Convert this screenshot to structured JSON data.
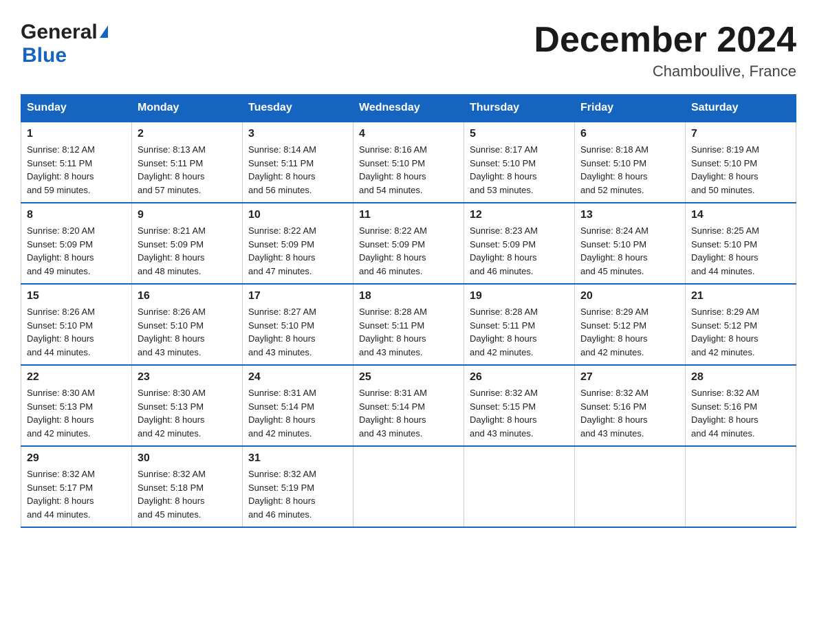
{
  "header": {
    "logo_general": "General",
    "logo_blue": "Blue",
    "title": "December 2024",
    "location": "Chamboulive, France"
  },
  "days_of_week": [
    "Sunday",
    "Monday",
    "Tuesday",
    "Wednesday",
    "Thursday",
    "Friday",
    "Saturday"
  ],
  "weeks": [
    [
      {
        "day": "1",
        "sunrise": "8:12 AM",
        "sunset": "5:11 PM",
        "daylight": "8 hours and 59 minutes."
      },
      {
        "day": "2",
        "sunrise": "8:13 AM",
        "sunset": "5:11 PM",
        "daylight": "8 hours and 57 minutes."
      },
      {
        "day": "3",
        "sunrise": "8:14 AM",
        "sunset": "5:11 PM",
        "daylight": "8 hours and 56 minutes."
      },
      {
        "day": "4",
        "sunrise": "8:16 AM",
        "sunset": "5:10 PM",
        "daylight": "8 hours and 54 minutes."
      },
      {
        "day": "5",
        "sunrise": "8:17 AM",
        "sunset": "5:10 PM",
        "daylight": "8 hours and 53 minutes."
      },
      {
        "day": "6",
        "sunrise": "8:18 AM",
        "sunset": "5:10 PM",
        "daylight": "8 hours and 52 minutes."
      },
      {
        "day": "7",
        "sunrise": "8:19 AM",
        "sunset": "5:10 PM",
        "daylight": "8 hours and 50 minutes."
      }
    ],
    [
      {
        "day": "8",
        "sunrise": "8:20 AM",
        "sunset": "5:09 PM",
        "daylight": "8 hours and 49 minutes."
      },
      {
        "day": "9",
        "sunrise": "8:21 AM",
        "sunset": "5:09 PM",
        "daylight": "8 hours and 48 minutes."
      },
      {
        "day": "10",
        "sunrise": "8:22 AM",
        "sunset": "5:09 PM",
        "daylight": "8 hours and 47 minutes."
      },
      {
        "day": "11",
        "sunrise": "8:22 AM",
        "sunset": "5:09 PM",
        "daylight": "8 hours and 46 minutes."
      },
      {
        "day": "12",
        "sunrise": "8:23 AM",
        "sunset": "5:09 PM",
        "daylight": "8 hours and 46 minutes."
      },
      {
        "day": "13",
        "sunrise": "8:24 AM",
        "sunset": "5:10 PM",
        "daylight": "8 hours and 45 minutes."
      },
      {
        "day": "14",
        "sunrise": "8:25 AM",
        "sunset": "5:10 PM",
        "daylight": "8 hours and 44 minutes."
      }
    ],
    [
      {
        "day": "15",
        "sunrise": "8:26 AM",
        "sunset": "5:10 PM",
        "daylight": "8 hours and 44 minutes."
      },
      {
        "day": "16",
        "sunrise": "8:26 AM",
        "sunset": "5:10 PM",
        "daylight": "8 hours and 43 minutes."
      },
      {
        "day": "17",
        "sunrise": "8:27 AM",
        "sunset": "5:10 PM",
        "daylight": "8 hours and 43 minutes."
      },
      {
        "day": "18",
        "sunrise": "8:28 AM",
        "sunset": "5:11 PM",
        "daylight": "8 hours and 43 minutes."
      },
      {
        "day": "19",
        "sunrise": "8:28 AM",
        "sunset": "5:11 PM",
        "daylight": "8 hours and 42 minutes."
      },
      {
        "day": "20",
        "sunrise": "8:29 AM",
        "sunset": "5:12 PM",
        "daylight": "8 hours and 42 minutes."
      },
      {
        "day": "21",
        "sunrise": "8:29 AM",
        "sunset": "5:12 PM",
        "daylight": "8 hours and 42 minutes."
      }
    ],
    [
      {
        "day": "22",
        "sunrise": "8:30 AM",
        "sunset": "5:13 PM",
        "daylight": "8 hours and 42 minutes."
      },
      {
        "day": "23",
        "sunrise": "8:30 AM",
        "sunset": "5:13 PM",
        "daylight": "8 hours and 42 minutes."
      },
      {
        "day": "24",
        "sunrise": "8:31 AM",
        "sunset": "5:14 PM",
        "daylight": "8 hours and 42 minutes."
      },
      {
        "day": "25",
        "sunrise": "8:31 AM",
        "sunset": "5:14 PM",
        "daylight": "8 hours and 43 minutes."
      },
      {
        "day": "26",
        "sunrise": "8:32 AM",
        "sunset": "5:15 PM",
        "daylight": "8 hours and 43 minutes."
      },
      {
        "day": "27",
        "sunrise": "8:32 AM",
        "sunset": "5:16 PM",
        "daylight": "8 hours and 43 minutes."
      },
      {
        "day": "28",
        "sunrise": "8:32 AM",
        "sunset": "5:16 PM",
        "daylight": "8 hours and 44 minutes."
      }
    ],
    [
      {
        "day": "29",
        "sunrise": "8:32 AM",
        "sunset": "5:17 PM",
        "daylight": "8 hours and 44 minutes."
      },
      {
        "day": "30",
        "sunrise": "8:32 AM",
        "sunset": "5:18 PM",
        "daylight": "8 hours and 45 minutes."
      },
      {
        "day": "31",
        "sunrise": "8:32 AM",
        "sunset": "5:19 PM",
        "daylight": "8 hours and 46 minutes."
      },
      null,
      null,
      null,
      null
    ]
  ],
  "labels": {
    "sunrise": "Sunrise:",
    "sunset": "Sunset:",
    "daylight": "Daylight:"
  }
}
